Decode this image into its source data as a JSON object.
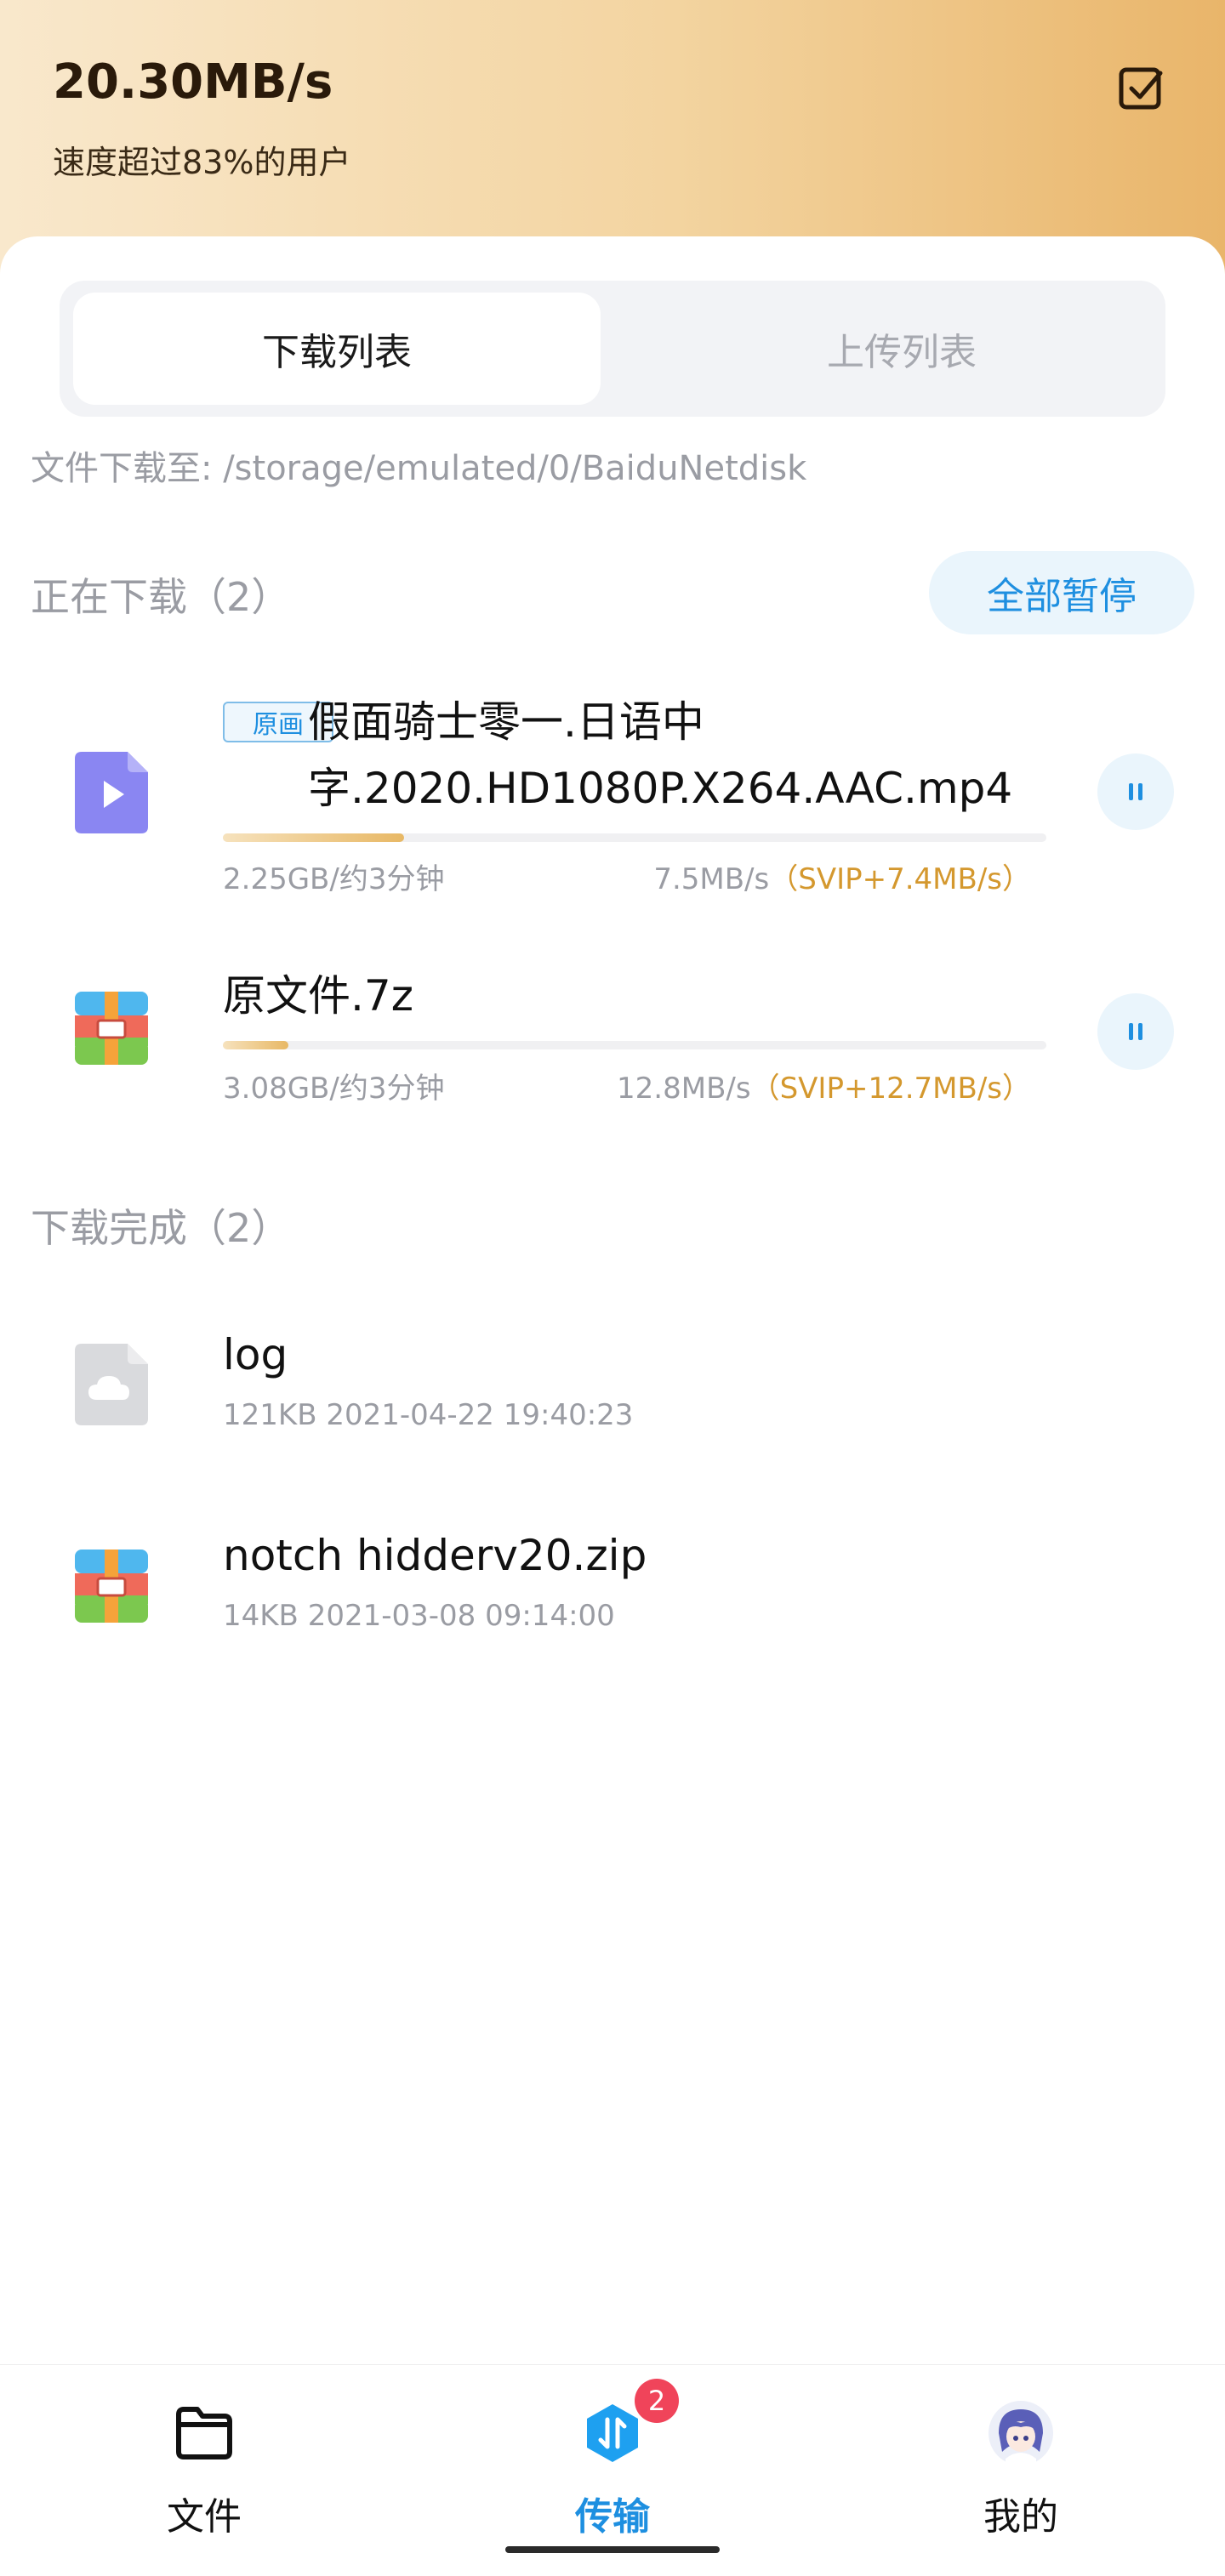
{
  "header": {
    "speed": "20.30MB/s",
    "subtitle": "速度超过83%的用户",
    "select_icon": "check-square-icon"
  },
  "tabs": [
    {
      "label": "下载列表",
      "active": true
    },
    {
      "label": "上传列表",
      "active": false
    }
  ],
  "download_path": "文件下载至: /storage/emulated/0/BaiduNetdisk",
  "downloading": {
    "title": "正在下载（2）",
    "pause_all_label": "全部暂停",
    "items": [
      {
        "icon": "video-file-icon",
        "badge": "原画",
        "name_line1": "假面骑士零一.日语中",
        "name_line2": "字.2020.HD1080P.X264.AAC.mp4",
        "progress": 0.22,
        "size_eta": "2.25GB/约3分钟",
        "speed": "7.5MB/s",
        "svip": "（SVIP+7.4MB/s）"
      },
      {
        "icon": "archive-file-icon",
        "name": "原文件.7z",
        "progress": 0.08,
        "size_eta": "3.08GB/约3分钟",
        "speed": "12.8MB/s",
        "svip": "（SVIP+12.7MB/s）"
      }
    ]
  },
  "completed": {
    "title": "下载完成（2）",
    "items": [
      {
        "icon": "cloud-file-icon",
        "name": "log",
        "meta": "121KB 2021-04-22 19:40:23"
      },
      {
        "icon": "archive-file-icon",
        "name": "notch hidderv20.zip",
        "meta": "14KB 2021-03-08 09:14:00"
      }
    ]
  },
  "bottom_nav": [
    {
      "label": "文件",
      "icon": "folder-icon",
      "active": false
    },
    {
      "label": "传输",
      "icon": "transfer-icon",
      "active": true,
      "badge": "2"
    },
    {
      "label": "我的",
      "icon": "avatar-icon",
      "active": false
    }
  ],
  "colors": {
    "accent": "#1e8fe0",
    "svip": "#d4982e",
    "badge_red": "#f0445a",
    "header_gradient_end": "#e9b56a"
  }
}
